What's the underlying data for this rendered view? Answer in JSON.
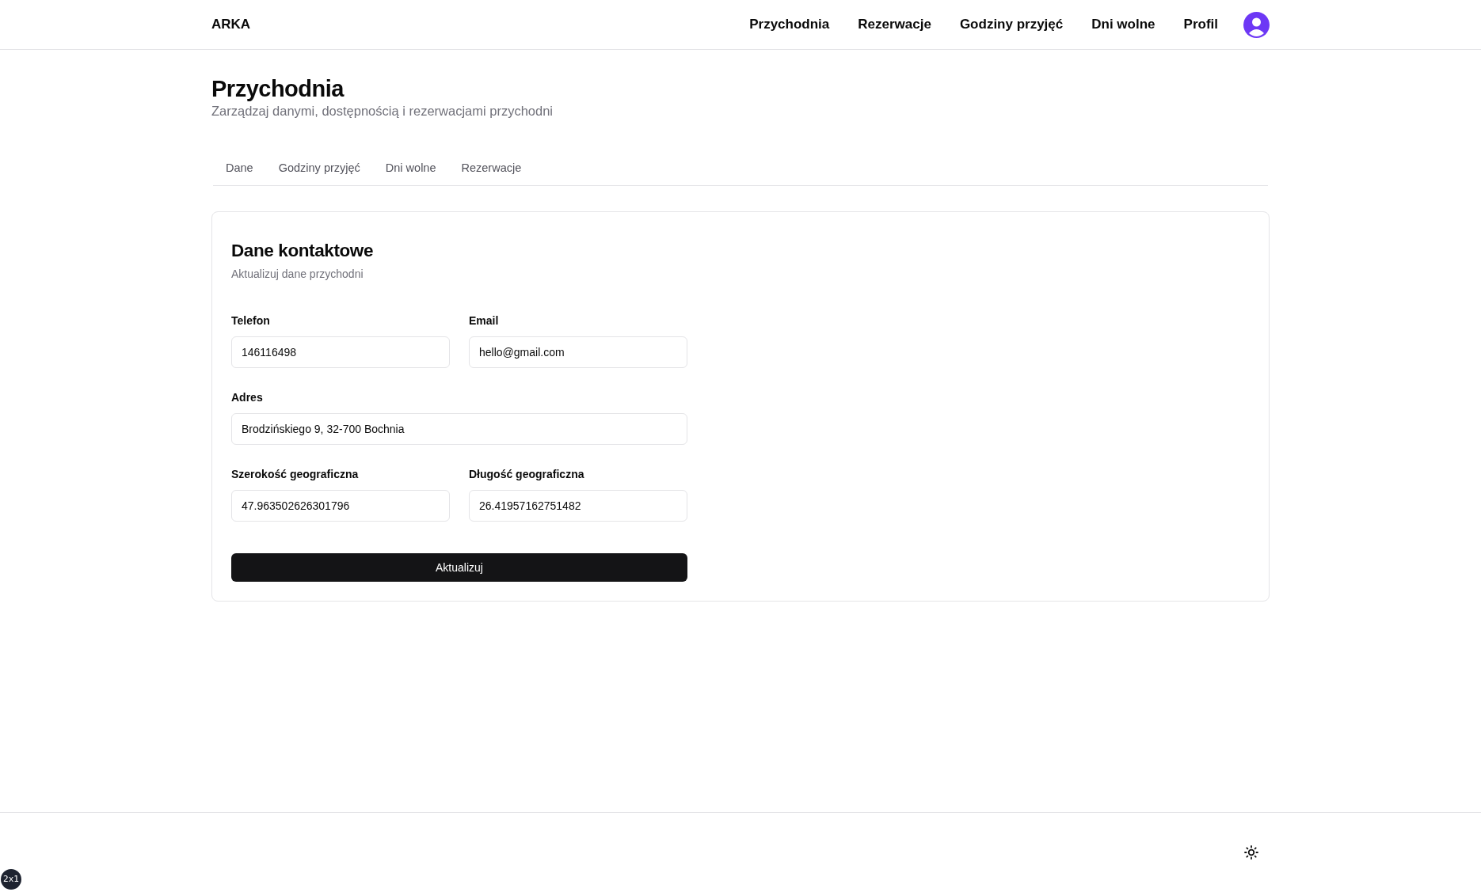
{
  "header": {
    "logo": "ARKA",
    "nav": [
      "Przychodnia",
      "Rezerwacje",
      "Godziny przyjęć",
      "Dni wolne",
      "Profil"
    ]
  },
  "page": {
    "title": "Przychodnia",
    "subtitle": "Zarządzaj danymi, dostępnością i rezerwacjami przychodni"
  },
  "tabs": [
    "Dane",
    "Godziny przyjęć",
    "Dni wolne",
    "Rezerwacje"
  ],
  "card": {
    "title": "Dane kontaktowe",
    "subtitle": "Aktualizuj dane przychodni",
    "fields": [
      {
        "label": "Telefon",
        "value": "146116498",
        "kind": "half"
      },
      {
        "label": "Email",
        "value": "hello@gmail.com",
        "kind": "half"
      },
      {
        "label": "Adres",
        "value": "Brodzińskiego 9, 32-700 Bochnia",
        "kind": "full"
      },
      {
        "label": "Szerokość geograficzna",
        "value": "47.963502626301796",
        "kind": "half"
      },
      {
        "label": "Długość geograficzna",
        "value": "26.41957162751482",
        "kind": "half"
      }
    ],
    "button": "Aktualizuj"
  },
  "badge": "2x1"
}
